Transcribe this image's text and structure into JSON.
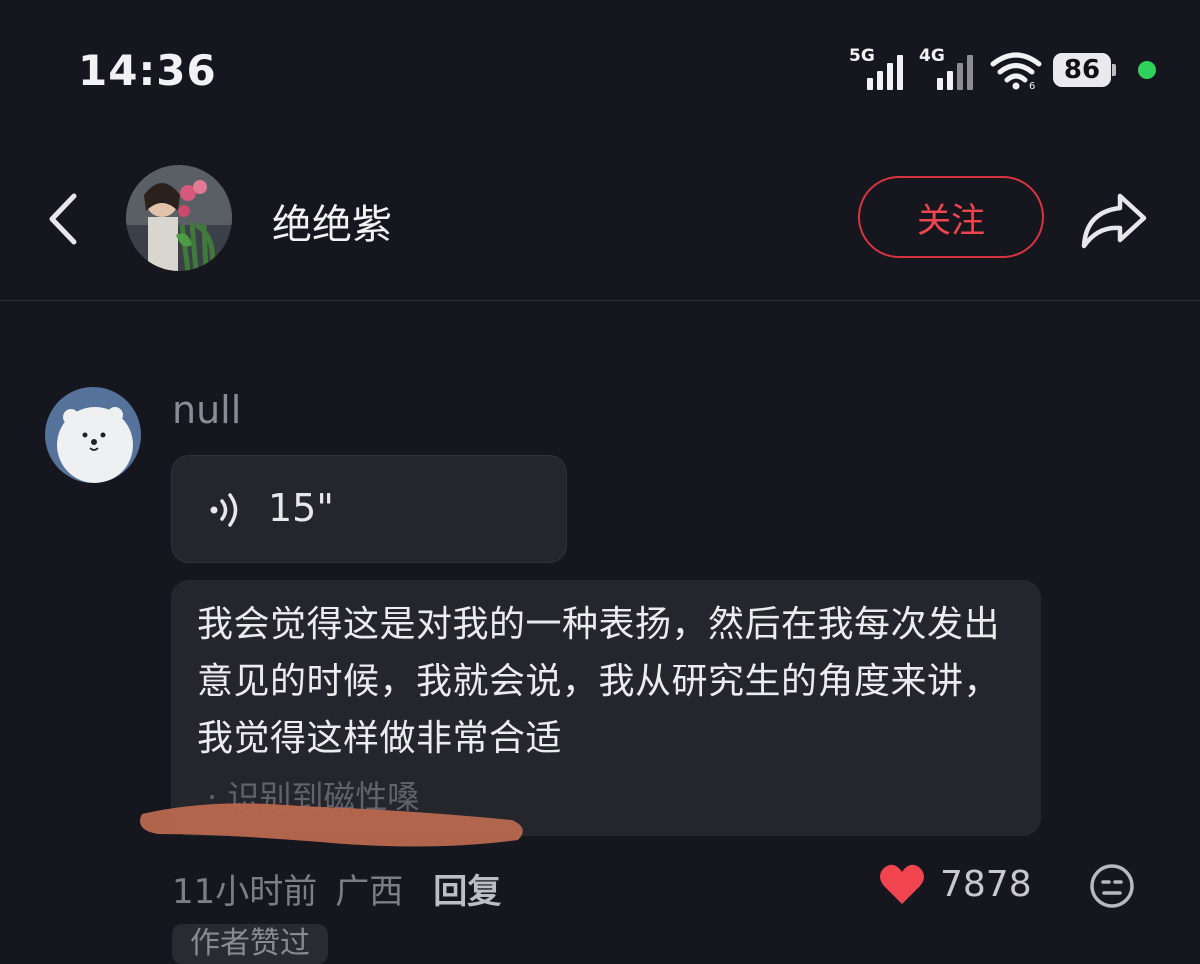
{
  "status_bar": {
    "time": "14:36",
    "net1": "5G",
    "net2": "4G",
    "battery": "86",
    "wifi_icon": "wifi-icon",
    "dot_color": "#2fd35c"
  },
  "header": {
    "back_icon": "chevron-left-icon",
    "name": "绝绝紫",
    "follow_label": "关注",
    "share_icon": "share-icon",
    "accent_color": "#f0444f"
  },
  "comment": {
    "username": "null",
    "voice_duration": "15\"",
    "transcript": "我会觉得这是对我的一种表扬，然后在我每次发出意见的时候，我就会说，我从研究生的角度来讲，我觉得这样做非常合适",
    "voice_tag": "· 识别到磁性嗓",
    "time": "11小时前",
    "location": "广西",
    "reply_label": "回复",
    "like_count": "7878",
    "author_tag": "作者赞过"
  }
}
